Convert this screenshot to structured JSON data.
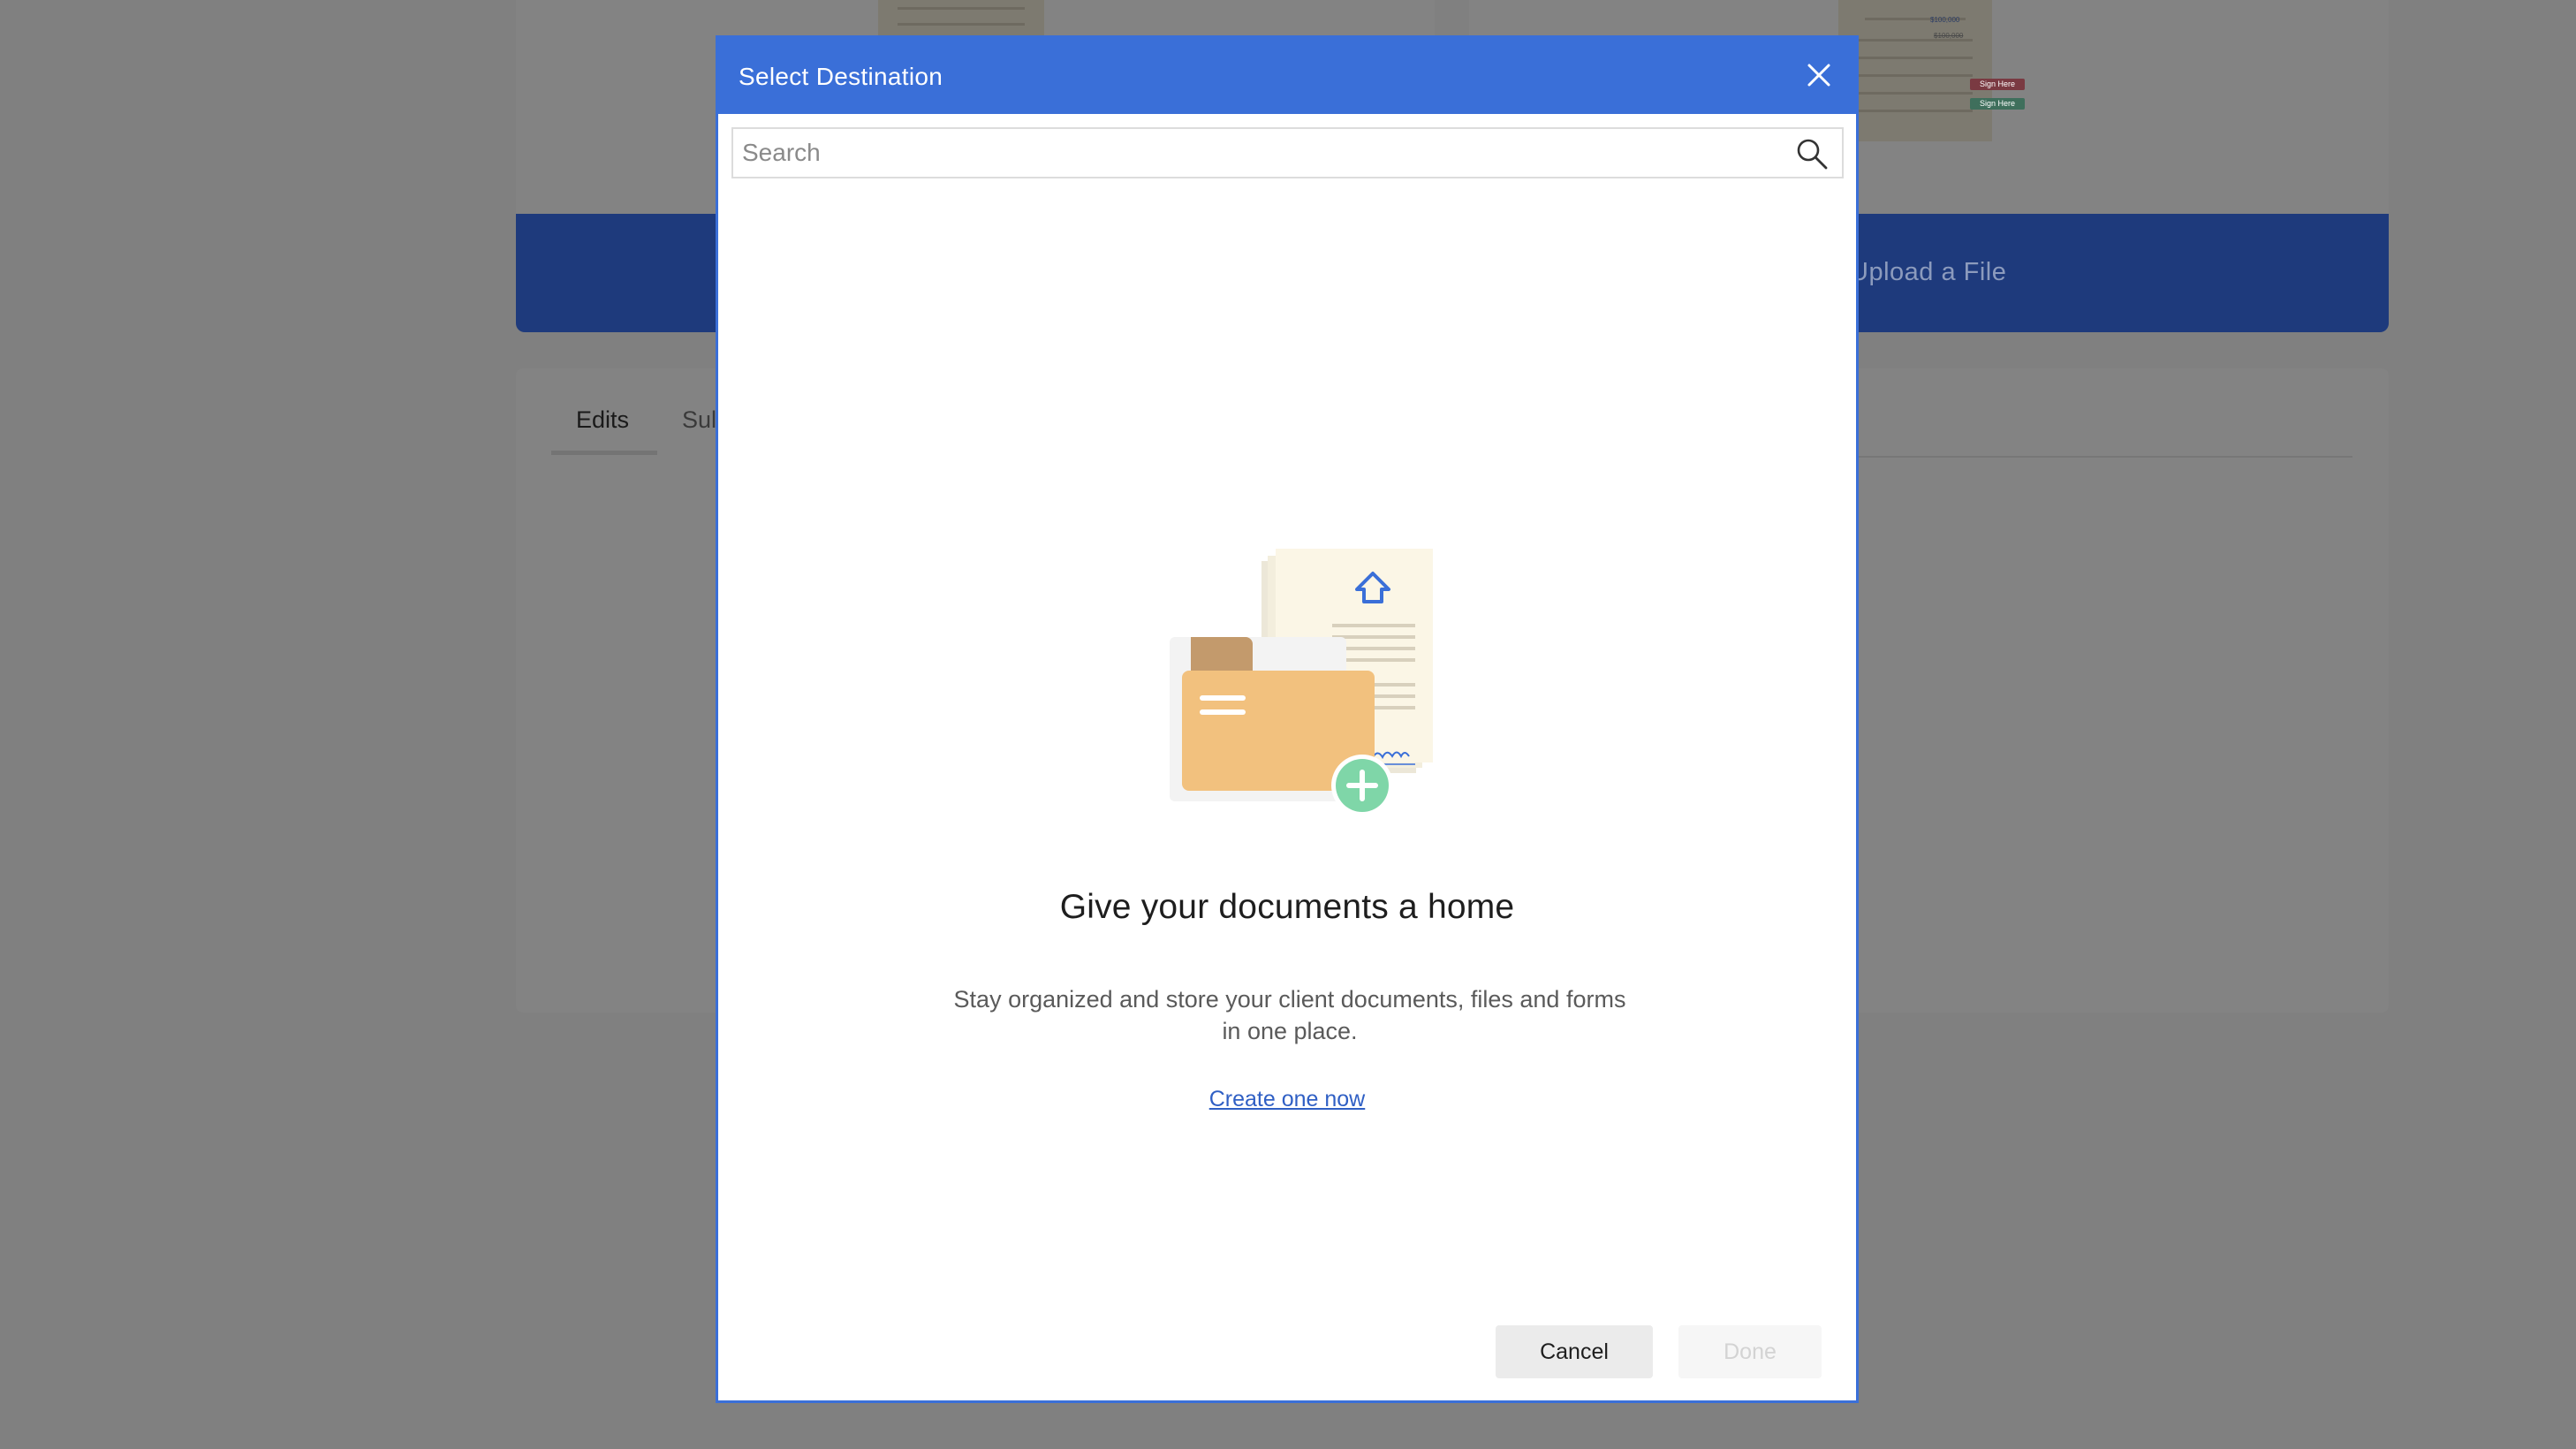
{
  "background": {
    "upload_label": "Upload a File",
    "tabs": [
      "Edits",
      "Sul"
    ],
    "thumb_tags": [
      "Sign Here",
      "Sign Here"
    ],
    "thumb_amounts": [
      "$100,000",
      "$100,000"
    ]
  },
  "modal": {
    "title": "Select Destination",
    "close_icon": "close-icon",
    "search": {
      "placeholder": "Search",
      "value": "",
      "icon": "search-icon"
    },
    "empty_state": {
      "illustration": "folder-document-add-illustration",
      "title": "Give your documents a home",
      "description": "Stay organized and store your client documents, files and forms in one place.",
      "link": "Create one now"
    },
    "buttons": {
      "cancel": "Cancel",
      "done": "Done"
    }
  },
  "colors": {
    "accent": "#3a6fd8",
    "link": "#2f5fc4",
    "folder": "#f2c17e",
    "folder_tab": "#c39a6c",
    "add": "#7fd6a8",
    "paper": "#fbf6e6",
    "tag_red": "#c43a4c",
    "tag_green": "#3aa87c"
  }
}
